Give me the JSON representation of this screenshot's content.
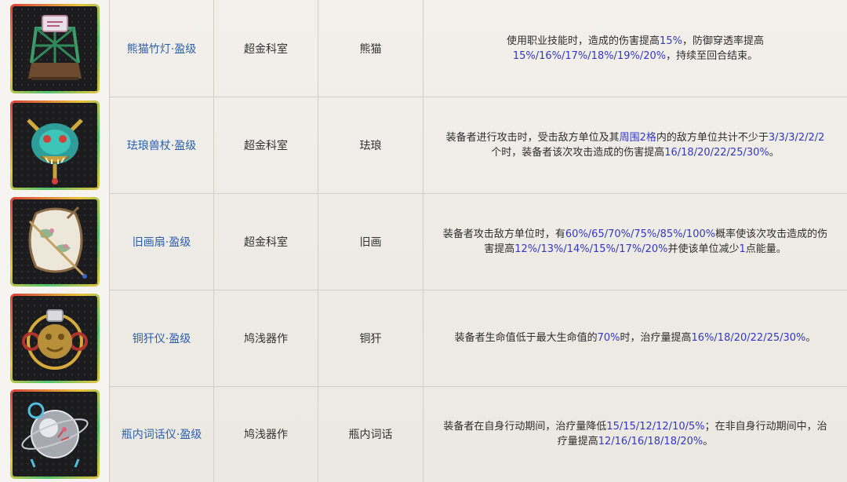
{
  "rows": [
    {
      "name": "熊猫竹灯·盈级",
      "source": "超金科室",
      "type": "熊猫",
      "icon": "panda-bamboo-lantern-icon",
      "desc": [
        {
          "t": "使用职业技能时，造成的伤害提高"
        },
        {
          "t": "15%",
          "hl": true
        },
        {
          "t": "，防御穿透率提高"
        },
        {
          "br": true
        },
        {
          "t": "15%/16%/17%/18%/19%/20%",
          "hl": true
        },
        {
          "t": "，持续至回合结束。"
        }
      ]
    },
    {
      "name": "珐琅兽杖·盈级",
      "source": "超金科室",
      "type": "珐琅",
      "icon": "enamel-beast-staff-icon",
      "desc": [
        {
          "t": "装备者进行攻击时，受击敌方单位及其"
        },
        {
          "t": "周围2格",
          "hl": true
        },
        {
          "t": "内的敌方单位共计不少于"
        },
        {
          "t": "3/3/3/2/2/2",
          "hl": true
        },
        {
          "br": true
        },
        {
          "t": "个时，装备者该次攻击造成的伤害提高"
        },
        {
          "t": "16/18/20/22/25/30%",
          "hl": true
        },
        {
          "t": "。"
        }
      ]
    },
    {
      "name": "旧画扇·盈级",
      "source": "超金科室",
      "type": "旧画",
      "icon": "old-painted-fan-icon",
      "desc": [
        {
          "t": "装备者攻击敌方单位时，有"
        },
        {
          "t": "60%/65/70%/75%/85%/100%",
          "hl": true
        },
        {
          "t": "概率使该次攻击造成的伤"
        },
        {
          "br": true
        },
        {
          "t": "害提高"
        },
        {
          "t": "12%/13%/14%/15%/17%/20%",
          "hl": true
        },
        {
          "t": "并使该单位减少"
        },
        {
          "t": "1",
          "hl": true
        },
        {
          "t": "点能量。"
        }
      ]
    },
    {
      "name": "铜犴仪·盈级",
      "source": "鸠浅器作",
      "type": "铜犴",
      "icon": "bronze-beast-instrument-icon",
      "desc": [
        {
          "t": "装备者生命值低于最大生命值的"
        },
        {
          "t": "70%",
          "hl": true
        },
        {
          "t": "时，治疗量提高"
        },
        {
          "t": "16%/18/20/22/25/30%",
          "hl": true
        },
        {
          "t": "。"
        }
      ]
    },
    {
      "name": "瓶内词话仪·盈级",
      "source": "鸠浅器作",
      "type": "瓶内词话",
      "icon": "bottle-sphere-instrument-icon",
      "desc": [
        {
          "t": "装备者在自身行动期间，治疗量降低"
        },
        {
          "t": "15/15/12/12/10/5%",
          "hl": true
        },
        {
          "t": "；在非自身行动期间中，治"
        },
        {
          "br": true
        },
        {
          "t": "疗量提高"
        },
        {
          "t": "12/16/16/18/18/20%",
          "hl": true
        },
        {
          "t": "。"
        }
      ]
    }
  ]
}
